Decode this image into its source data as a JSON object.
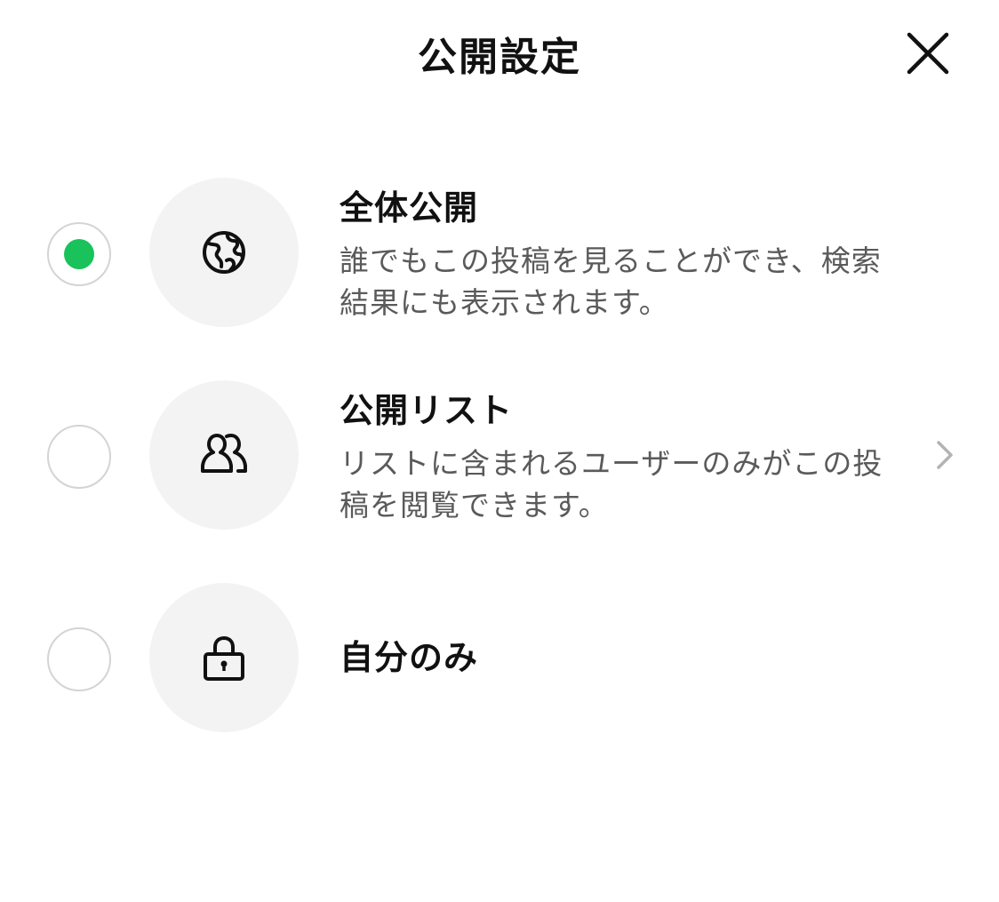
{
  "header": {
    "title": "公開設定",
    "close_icon": "close-icon"
  },
  "options": [
    {
      "title": "全体公開",
      "description": "誰でもこの投稿を見ることができ、検索結果にも表示されます。",
      "icon": "globe-icon",
      "selected": true,
      "has_chevron": false
    },
    {
      "title": "公開リスト",
      "description": "リストに含まれるユーザーのみがこの投稿を閲覧できます。",
      "icon": "users-icon",
      "selected": false,
      "has_chevron": true
    },
    {
      "title": "自分のみ",
      "description": "",
      "icon": "lock-icon",
      "selected": false,
      "has_chevron": false
    }
  ],
  "colors": {
    "accent": "#19c25b",
    "icon_bg": "#f3f3f3",
    "radio_border": "#d4d4d4",
    "description_text": "#5a5a5a"
  }
}
